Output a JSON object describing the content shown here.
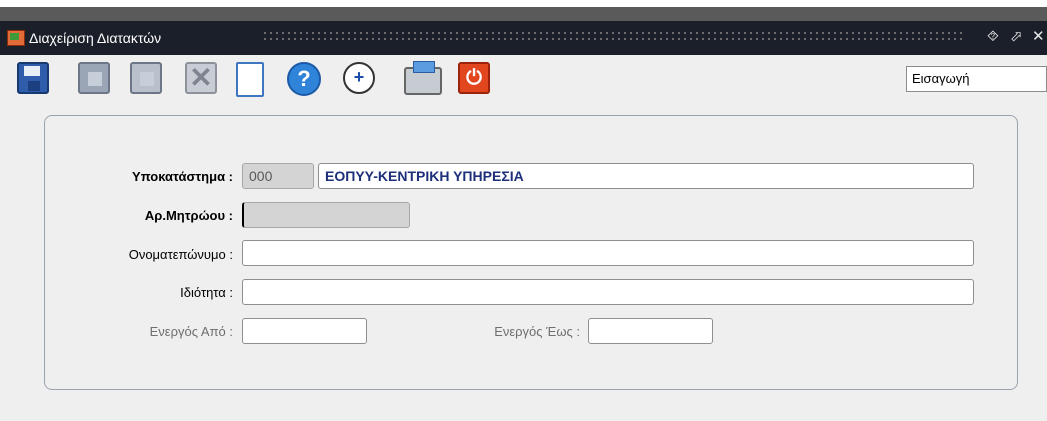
{
  "window": {
    "title": "Διαχείριση Διατακτών",
    "minimize_glyph": "⯑",
    "maximize_glyph": "⬀",
    "close_glyph": "✕"
  },
  "toolbar": {
    "icons": [
      "save-icon",
      "list-icon",
      "edit-icon",
      "delete-icon",
      "new-document-icon",
      "help-icon",
      "zoom-icon",
      "print-icon",
      "exit-icon"
    ],
    "help_glyph": "?",
    "zoom_glyph": "+",
    "exit_glyph": "⏻",
    "delete_glyph": "✕"
  },
  "mode": {
    "value": "Εισαγωγή"
  },
  "form": {
    "branch": {
      "label": "Υποκατάστημα :",
      "code": "000",
      "name": "ΕΟΠΥΥ-ΚΕΝΤΡΙΚΗ ΥΠΗΡΕΣΙΑ"
    },
    "registry": {
      "label": "Αρ.Μητρώου :",
      "value": ""
    },
    "fullname": {
      "label": "Ονοματεπώνυμο :",
      "value": ""
    },
    "specialty": {
      "label": "Ιδιότητα :",
      "value": ""
    },
    "active_from": {
      "label": "Ενεργός Από :",
      "value": ""
    },
    "active_to": {
      "label": "Ενεργός Έως :",
      "value": ""
    }
  },
  "colors": {
    "title_bar": "#1b1f2a",
    "name_text": "#1d2f7a",
    "background": "#efefef"
  }
}
